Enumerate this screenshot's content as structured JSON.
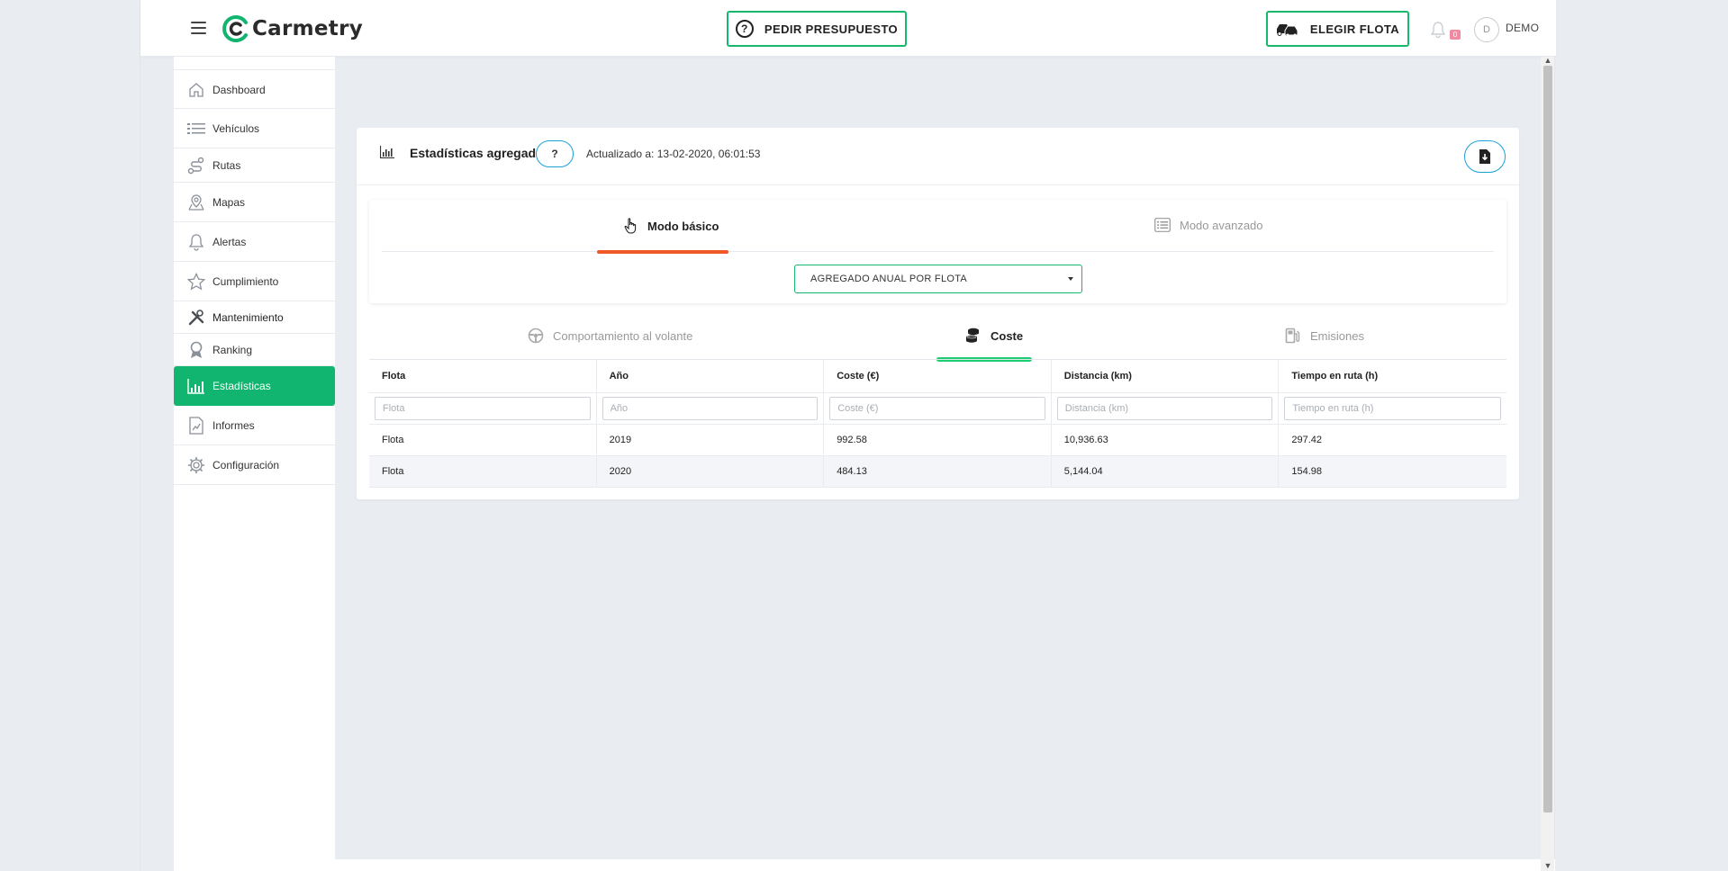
{
  "header": {
    "logo_text": "Carmetry",
    "budget_button": "PEDIR PRESUPUESTO",
    "fleet_button": "ELEGIR FLOTA",
    "notifications_count": "0",
    "avatar_initial": "D",
    "user_name": "DEMO"
  },
  "sidebar": {
    "items": [
      {
        "label": "Dashboard",
        "icon": "home-icon"
      },
      {
        "label": "Vehículos",
        "icon": "list-icon"
      },
      {
        "label": "Rutas",
        "icon": "route-icon"
      },
      {
        "label": "Mapas",
        "icon": "map-icon"
      },
      {
        "label": "Alertas",
        "icon": "bell-icon"
      },
      {
        "label": "Cumplimiento",
        "icon": "star-icon"
      },
      {
        "label": "Mantenimiento",
        "icon": "wrench-icon"
      },
      {
        "label": "Ranking",
        "icon": "medal-icon"
      },
      {
        "label": "Estadísticas",
        "icon": "chart-icon",
        "active": true
      },
      {
        "label": "Informes",
        "icon": "report-icon"
      },
      {
        "label": "Configuración",
        "icon": "gear-icon"
      }
    ]
  },
  "card": {
    "title": "Estadísticas agregadas",
    "help_label": "?",
    "updated": "Actualizado a: 13-02-2020, 06:01:53"
  },
  "modes": {
    "basic": "Modo básico",
    "advanced": "Modo avanzado",
    "active": "basic"
  },
  "aggregate_select": {
    "value": "AGREGADO ANUAL POR FLOTA"
  },
  "subtabs": {
    "behavior": "Comportamiento al volante",
    "cost": "Coste",
    "emissions": "Emisiones",
    "active": "cost"
  },
  "table": {
    "columns": [
      "Flota",
      "Año",
      "Coste (€)",
      "Distancia (km)",
      "Tiempo en ruta (h)"
    ],
    "filter_placeholders": [
      "Flota",
      "Año",
      "Coste (€)",
      "Distancia (km)",
      "Tiempo en ruta (h)"
    ],
    "rows": [
      [
        "Flota",
        "2019",
        "992.58",
        "10,936.63",
        "297.42"
      ],
      [
        "Flota",
        "2020",
        "484.13",
        "5,144.04",
        "154.98"
      ]
    ]
  },
  "colors": {
    "brand_green": "#12b56f",
    "accent_orange": "#f05a28",
    "accent_blue": "#1aa0d8"
  }
}
